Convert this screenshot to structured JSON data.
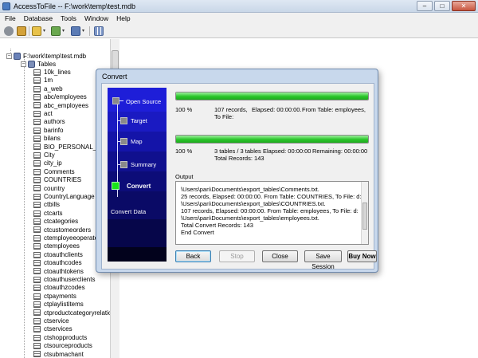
{
  "window": {
    "title": "AccessToFile -- F:\\work\\temp\\test.mdb"
  },
  "window_controls": {
    "minimize": "–",
    "maximize": "□",
    "close": "✕"
  },
  "menu": [
    "File",
    "Database",
    "Tools",
    "Window",
    "Help"
  ],
  "toolbar": {
    "icons": [
      "connect-icon",
      "open-database-icon",
      "new-file-icon",
      "table-icon",
      "export-icon",
      "grid-view-icon"
    ],
    "dropdown_glyph": "▾"
  },
  "tree": {
    "db_path": "F:\\work\\temp\\test.mdb",
    "tables_label": "Tables",
    "tables": [
      "10k_lines",
      "1m",
      "a_web",
      "abc/employees",
      "abc_employees",
      "act",
      "authors",
      "barinfo",
      "bilans",
      "BIO_PERSONAL_INFO",
      "City",
      "city_ip",
      "Comments",
      "COUNTRIES",
      "country",
      "CountryLanguage",
      "ctbills",
      "ctcarts",
      "ctcategories",
      "ctcustomeorders",
      "ctemployeeoperatelogs",
      "ctemployees",
      "ctoauthclients",
      "ctoauthcodes",
      "ctoauthtokens",
      "ctoauthuserclients",
      "ctoauthzcodes",
      "ctpayments",
      "ctplaylistitems",
      "ctproductcategoryrelations",
      "ctservice",
      "ctservices",
      "ctshopproducts",
      "ctsourceproducts",
      "ctsubmachant"
    ]
  },
  "dialog": {
    "title": "Convert",
    "steps": [
      "Open Source",
      "Target",
      "Map",
      "Summary",
      "Convert"
    ],
    "active_step": "Convert",
    "footer_label": "Convert Data",
    "progress1": {
      "percent_value": 100,
      "percent": "100 %",
      "records": "107 records,",
      "elapsed": "Elapsed: 00:00:00.",
      "from_table": "From Table: employees,",
      "to_file": "To File:"
    },
    "progress2": {
      "percent_value": 100,
      "percent": "100 %",
      "tables": "3 tables / 3 tables",
      "elapsed": "Elapsed: 00:00:00",
      "remaining": "Remaining: 00:00:00",
      "total": "Total Records: 143"
    },
    "output_label": "Output",
    "output_lines": [
      "\\Users\\pan\\Documents\\export_tables\\Comments.txt.",
      "25 records,     Elapsed: 00:00:00.     From Table: COUNTRIES,     To File: d:",
      "\\Users\\pan\\Documents\\export_tables\\COUNTRIES.txt.",
      "107 records,     Elapsed: 00:00:00.     From Table: employees,     To File: d:",
      "\\Users\\pan\\Documents\\export_tables\\employees.txt.",
      "Total Convert Records: 143",
      "End Convert"
    ],
    "buttons": {
      "back": "Back",
      "stop": "Stop",
      "close": "Close",
      "save_session": "Save Session",
      "buy_now": "Buy Now"
    }
  }
}
